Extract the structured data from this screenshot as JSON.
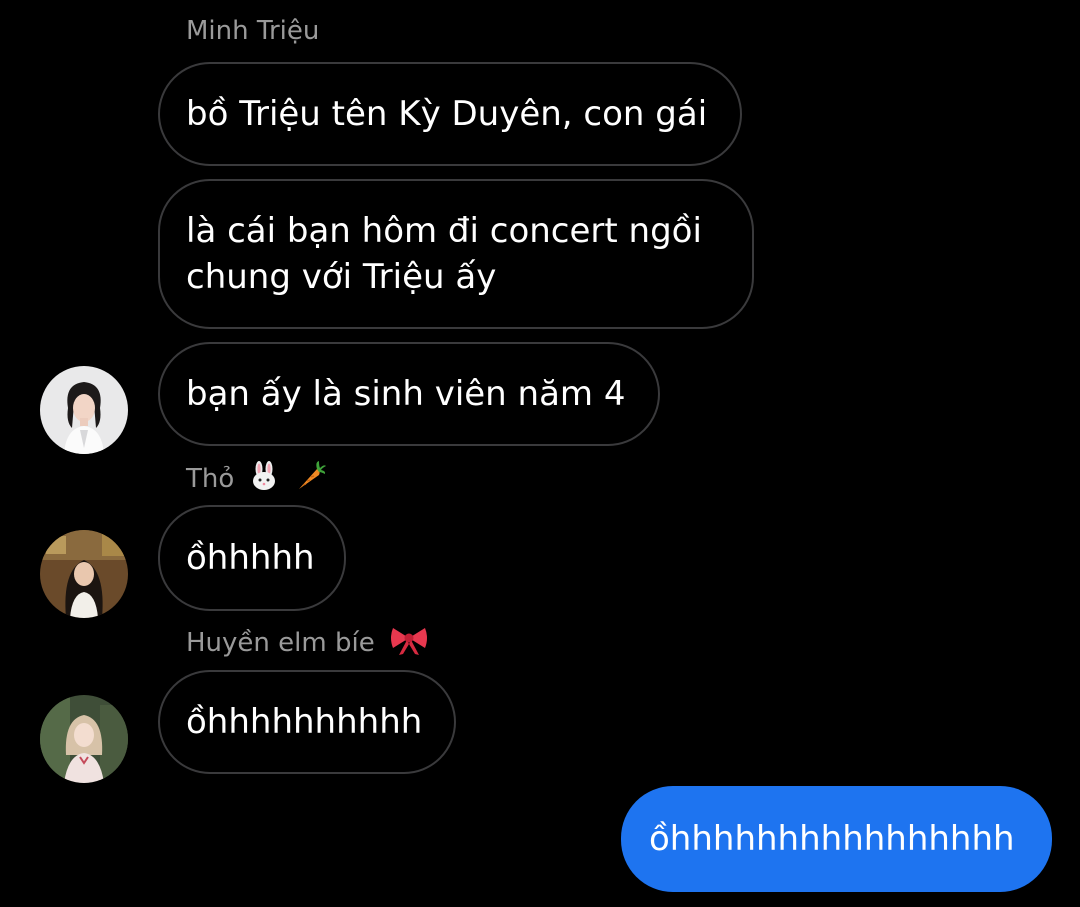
{
  "messages": [
    {
      "sender": "Minh Triệu",
      "text": "bồ Triệu tên Kỳ Duyên, con gái"
    },
    {
      "text_line1": "là cái bạn hôm đi concert ngồi",
      "text_line2": "chung với Triệu ấy"
    },
    {
      "text": "bạn ấy là sinh viên năm 4"
    },
    {
      "sender": "Thỏ",
      "sender_emoji": [
        "rabbit-face",
        "carrot"
      ],
      "text": "ồhhhhh"
    },
    {
      "sender": "Huyền elm bíe",
      "sender_emoji": [
        "ribbon"
      ],
      "text": "ồhhhhhhhhhh"
    },
    {
      "from_me": true,
      "text": "ồhhhhhhhhhhhhhhhh"
    }
  ],
  "colors": {
    "background": "#000000",
    "received_bubble_border": "#3a3a3c",
    "sent_bubble": "#1e74f0",
    "sender_name": "#9a9a9a"
  }
}
